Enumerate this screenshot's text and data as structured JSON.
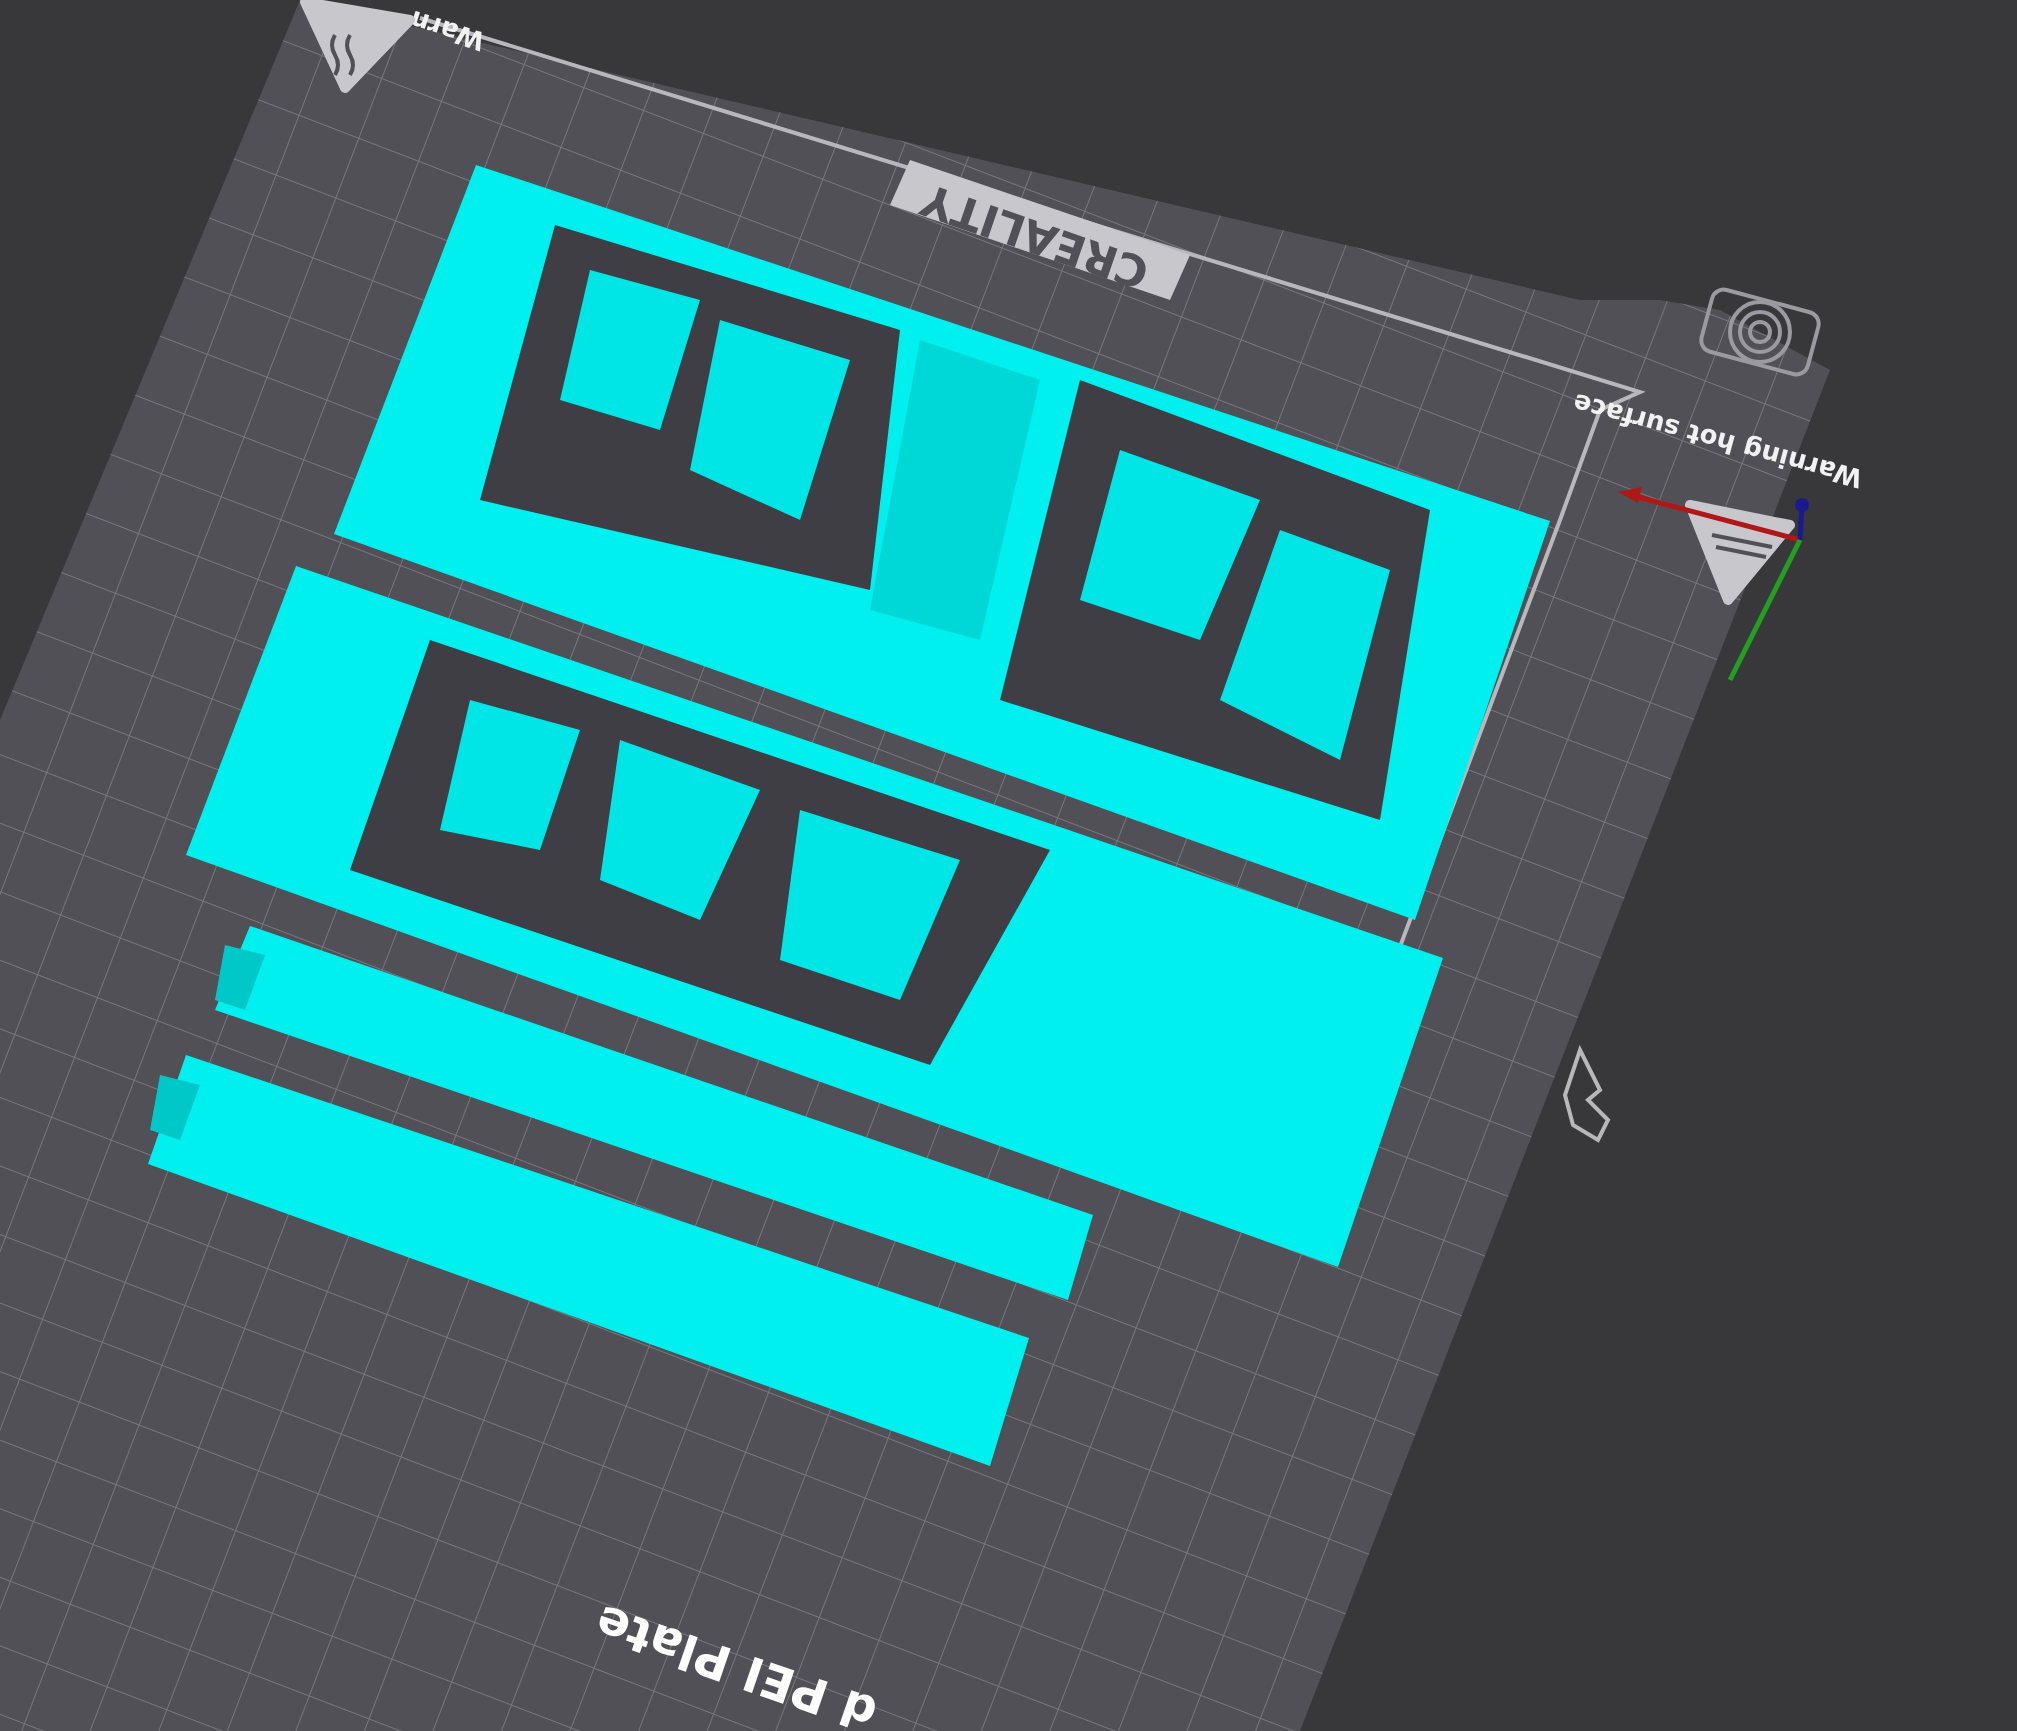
{
  "viewport": {
    "bed": {
      "brand": "CREALITY",
      "warnings": [
        "Warn",
        "Warning hot surface"
      ],
      "plate_name": "d PEI Plate"
    }
  }
}
